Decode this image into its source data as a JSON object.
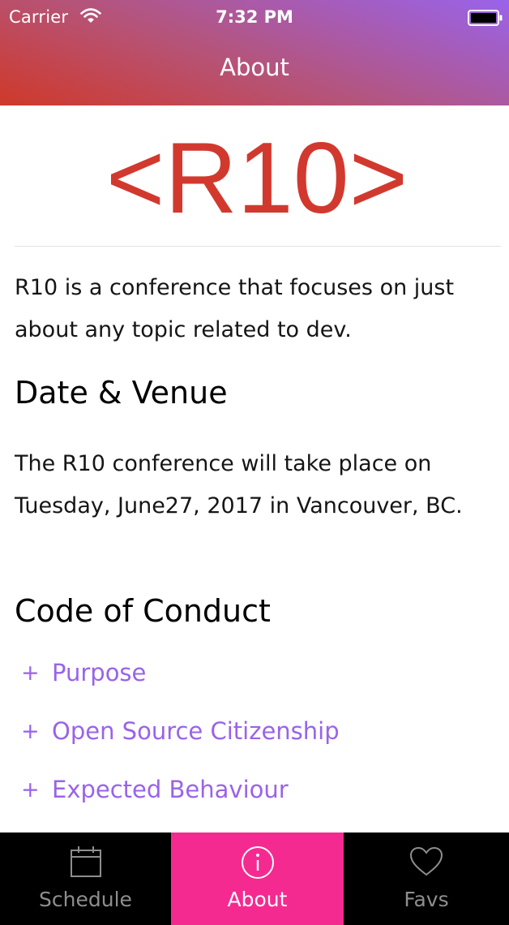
{
  "status_bar": {
    "carrier": "Carrier",
    "time": "7:32 PM"
  },
  "header": {
    "title": "About"
  },
  "logo": {
    "text": "<R10>",
    "color": "#d2392e"
  },
  "intro": "R10 is a conference that focuses on just about any topic related to dev.",
  "date_venue": {
    "heading": "Date & Venue",
    "text": "The R10 conference will take place on Tuesday, June27, 2017 in Vancouver, BC."
  },
  "code_of_conduct": {
    "heading": "Code of Conduct",
    "items": [
      {
        "icon": "+",
        "label": "Purpose"
      },
      {
        "icon": "+",
        "label": "Open Source Citizenship"
      },
      {
        "icon": "+",
        "label": "Expected Behaviour"
      }
    ]
  },
  "tabs": [
    {
      "label": "Schedule",
      "icon": "calendar-icon",
      "active": false
    },
    {
      "label": "About",
      "icon": "info-icon",
      "active": true
    },
    {
      "label": "Favs",
      "icon": "heart-icon",
      "active": false
    }
  ],
  "colors": {
    "accent": "#9a63e8",
    "active_tab": "#f52a90",
    "header_gradient_start": "#9963ea",
    "header_gradient_end": "#cf392a"
  }
}
